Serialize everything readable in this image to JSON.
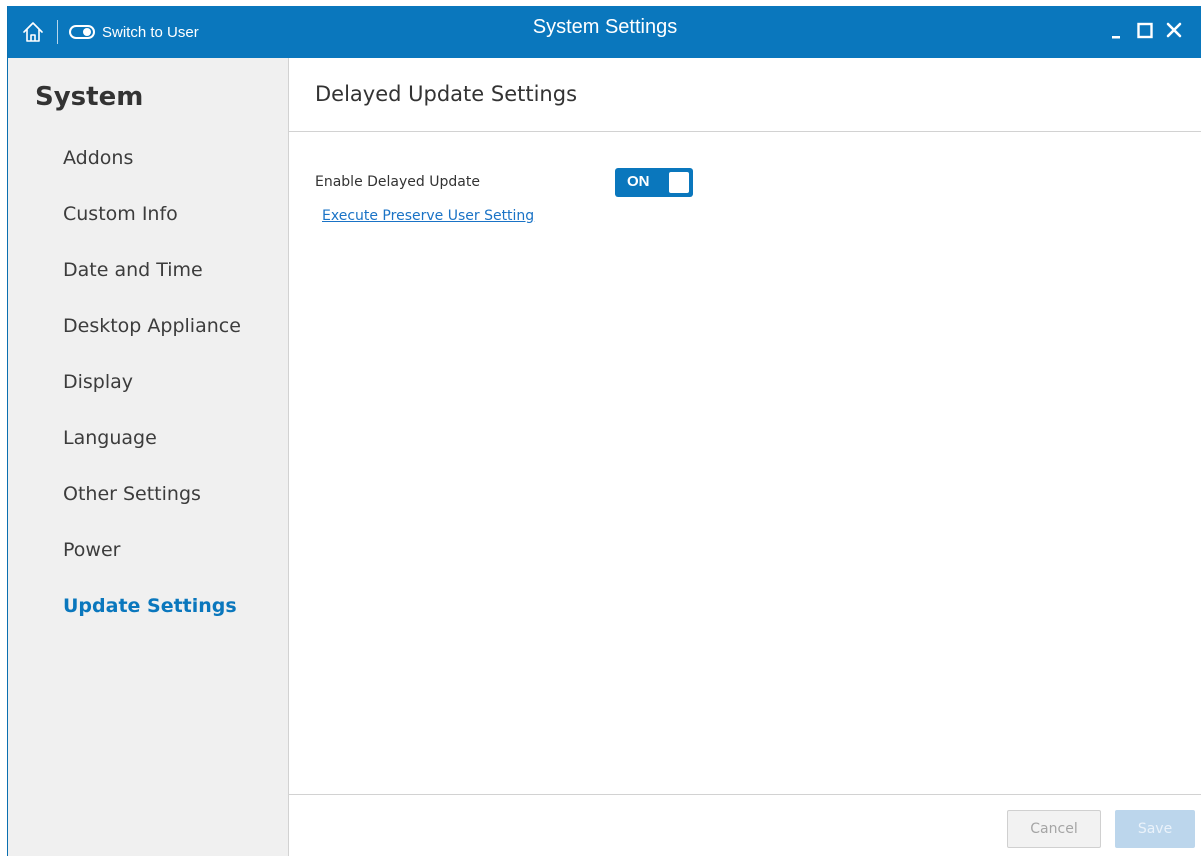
{
  "titlebar": {
    "title": "System Settings",
    "switch_label": "Switch to User",
    "background": "#0a77bd",
    "icons": [
      "home-icon",
      "toggle-icon",
      "minimize-icon",
      "maximize-icon",
      "close-icon"
    ]
  },
  "sidebar": {
    "title": "System",
    "items": [
      {
        "label": "Addons"
      },
      {
        "label": "Custom Info"
      },
      {
        "label": "Date and Time"
      },
      {
        "label": "Desktop Appliance"
      },
      {
        "label": "Display"
      },
      {
        "label": "Language"
      },
      {
        "label": "Other Settings"
      },
      {
        "label": "Power"
      },
      {
        "label": "Update Settings",
        "active": true
      }
    ],
    "active_color": "#0a77bd"
  },
  "main": {
    "page_title": "Delayed Update Settings",
    "enable_delayed_update": {
      "label": "Enable Delayed Update",
      "toggle_text": "ON",
      "state": true
    },
    "preserve_link": "Execute Preserve User Setting"
  },
  "footer": {
    "cancel_label": "Cancel",
    "save_label": "Save"
  }
}
